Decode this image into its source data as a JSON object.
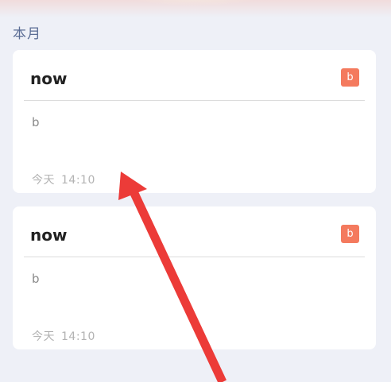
{
  "section": {
    "title": "本月"
  },
  "notes": [
    {
      "title": "now",
      "badge": "b",
      "body": "b",
      "date": "今天",
      "time": "14:10"
    },
    {
      "title": "now",
      "badge": "b",
      "body": "b",
      "date": "今天",
      "time": "14:10"
    }
  ],
  "colors": {
    "badge": "#f47a5e",
    "annotation_arrow": "#ec3b38",
    "background": "#eef0f7"
  }
}
